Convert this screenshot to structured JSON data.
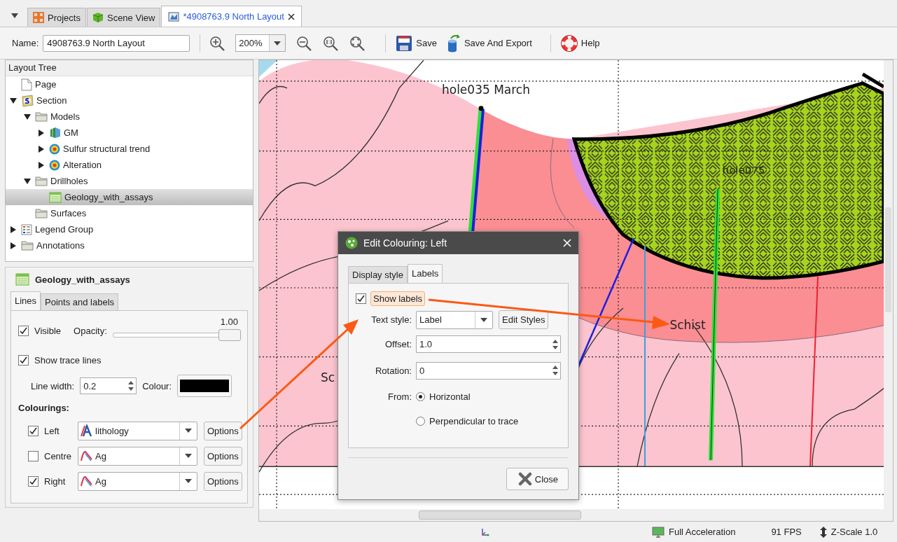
{
  "tabs": [
    {
      "label": "Projects",
      "kind": "projects",
      "selected": false
    },
    {
      "label": "Scene View",
      "kind": "scene",
      "selected": false
    },
    {
      "label": "*4908763.9 North Layout",
      "kind": "layout",
      "selected": true
    }
  ],
  "toolbar": {
    "name_label": "Name:",
    "name_value": "4908763.9 North Layout",
    "zoom": "200%",
    "save": "Save",
    "save_export": "Save And Export",
    "help": "Help"
  },
  "layout_tree": {
    "title": "Layout Tree",
    "items": [
      {
        "label": "Page",
        "kind": "page",
        "selected": false
      },
      {
        "label": "Section",
        "kind": "section",
        "expanded": true,
        "selected": false,
        "children": [
          {
            "label": "Models",
            "kind": "folder",
            "expanded": true,
            "selected": false,
            "children": [
              {
                "label": "GM",
                "kind": "geomodel",
                "expanded": false,
                "selected": false
              },
              {
                "label": "Sulfur structural trend",
                "kind": "target",
                "expanded": false,
                "selected": false
              },
              {
                "label": "Alteration",
                "kind": "target",
                "expanded": false,
                "selected": false
              }
            ]
          },
          {
            "label": "Drillholes",
            "kind": "folder",
            "expanded": true,
            "selected": false,
            "children": [
              {
                "label": "Geology_with_assays",
                "kind": "table",
                "selected": true
              }
            ]
          },
          {
            "label": "Surfaces",
            "kind": "folder",
            "selected": false
          }
        ]
      },
      {
        "label": "Legend Group",
        "kind": "legend",
        "expanded": false,
        "selected": false
      },
      {
        "label": "Annotations",
        "kind": "folder",
        "expanded": false,
        "selected": false
      }
    ]
  },
  "properties": {
    "title": "Geology_with_assays",
    "tabs": [
      {
        "label": "Lines",
        "selected": true
      },
      {
        "label": "Points and labels",
        "selected": false
      }
    ],
    "visible": {
      "label": "Visible",
      "checked": true
    },
    "opacity": {
      "label": "Opacity:",
      "reading": "1.00",
      "level": 1.0
    },
    "show_trace": {
      "label": "Show trace lines",
      "checked": true
    },
    "line_width": {
      "label": "Line width:",
      "value": "0.2"
    },
    "colour_label": "Colour:",
    "colourings_title": "Colourings:",
    "colourings": [
      {
        "label": "Left",
        "checked": true,
        "kind": "category",
        "value": "lithology",
        "button": "Options"
      },
      {
        "label": "Centre",
        "checked": false,
        "kind": "numeric",
        "value": "Ag",
        "button": "Options"
      },
      {
        "label": "Right",
        "checked": true,
        "kind": "numeric",
        "value": "Ag",
        "button": "Options"
      }
    ]
  },
  "viewport": {
    "labels": [
      {
        "text": "hole035 March",
        "kind": "hole"
      },
      {
        "text": "hole075",
        "kind": "hole-small"
      },
      {
        "text": "Schist",
        "kind": "unit"
      },
      {
        "text": "Sc",
        "kind": "unit-cut"
      }
    ]
  },
  "dialog": {
    "title": "Edit Colouring: Left",
    "tabs": [
      {
        "label": "Display style",
        "selected": false
      },
      {
        "label": "Labels",
        "selected": true
      }
    ],
    "show_labels": {
      "label": "Show labels",
      "checked": true
    },
    "text_style": {
      "label": "Text style:",
      "value": "Label"
    },
    "edit_styles": "Edit Styles",
    "offset": {
      "label": "Offset:",
      "value": "1.0"
    },
    "rotation": {
      "label": "Rotation:",
      "value": "0"
    },
    "from_label": "From:",
    "from_options": [
      {
        "label": "Horizontal",
        "selected": true
      },
      {
        "label": "Perpendicular to trace",
        "selected": false
      }
    ],
    "close": "Close"
  },
  "status_bar": {
    "acceleration": "Full Acceleration",
    "fps": "91 FPS",
    "z_scale": "Z-Scale 1.0"
  }
}
